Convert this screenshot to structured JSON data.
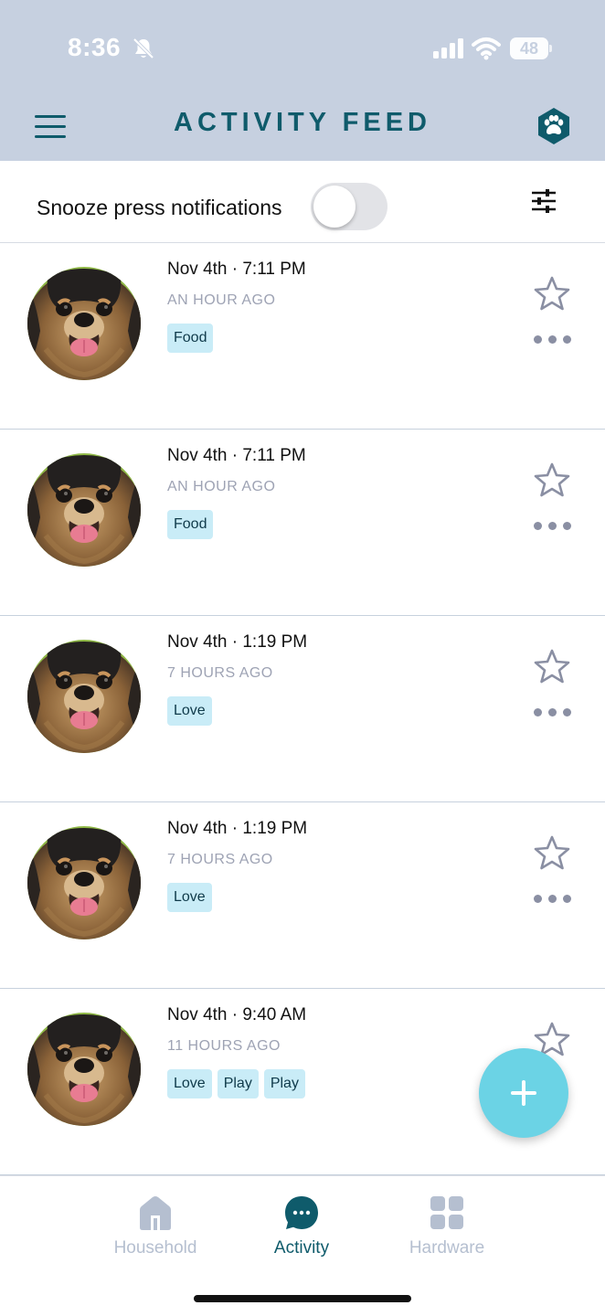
{
  "status_bar": {
    "time": "8:36",
    "battery": "48",
    "icons": [
      "bell-slash-icon",
      "cellular-signal-icon",
      "wifi-icon",
      "battery-icon"
    ]
  },
  "header": {
    "title": "ACTIVITY FEED",
    "left_icon": "hamburger-menu-icon",
    "right_icon": "paw-icon",
    "accent_color": "#0f5b6b",
    "background_color": "#c6d0e0"
  },
  "snooze": {
    "label": "Snooze press notifications",
    "enabled": false,
    "filter_icon": "sliders-icon"
  },
  "feed": {
    "items": [
      {
        "date": "Nov 4th · 7:11 PM",
        "ago": "AN HOUR AGO",
        "tags": [
          "Food"
        ]
      },
      {
        "date": "Nov 4th · 7:11 PM",
        "ago": "AN HOUR AGO",
        "tags": [
          "Food"
        ]
      },
      {
        "date": "Nov 4th · 1:19 PM",
        "ago": "7 HOURS AGO",
        "tags": [
          "Love"
        ]
      },
      {
        "date": "Nov 4th · 1:19 PM",
        "ago": "7 HOURS AGO",
        "tags": [
          "Love"
        ]
      },
      {
        "date": "Nov 4th · 9:40 AM",
        "ago": "11 HOURS AGO",
        "tags": [
          "Love",
          "Play",
          "Play"
        ]
      }
    ],
    "tag_color": "#c9ecf7"
  },
  "fab": {
    "icon": "plus-icon",
    "color": "#6bd3e5"
  },
  "tabbar": {
    "tabs": [
      {
        "label": "Household",
        "icon": "house-icon",
        "active": false
      },
      {
        "label": "Activity",
        "icon": "chat-bubble-icon",
        "active": true
      },
      {
        "label": "Hardware",
        "icon": "grid-icon",
        "active": false
      }
    ],
    "active_color": "#0f5b6b",
    "inactive_color": "#b5bfd0"
  }
}
